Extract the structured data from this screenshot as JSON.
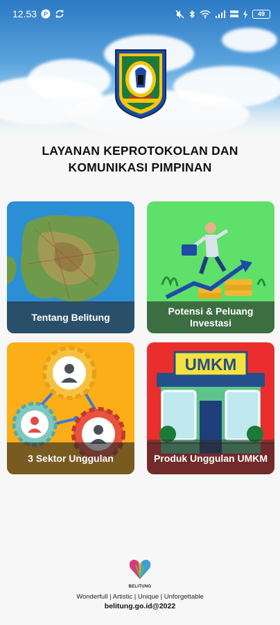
{
  "status_bar": {
    "time": "12.53",
    "battery": "49",
    "left_icons": [
      "parking-notification-icon",
      "sync-icon"
    ],
    "right_icons": [
      "mute-icon",
      "bluetooth-icon",
      "wifi-icon",
      "signal-icon",
      "data-speed-icon",
      "charging-icon"
    ]
  },
  "header": {
    "title_line1": "LAYANAN KEPROTOKOLAN DAN",
    "title_line2": "KOMUNIKASI PIMPINAN"
  },
  "menu": {
    "items": [
      {
        "label": "Tentang Belitung",
        "icon": "island-map-icon",
        "bg_color": "#2b8fd6"
      },
      {
        "label": "Potensi & Peluang Investasi",
        "icon": "investment-growth-icon",
        "bg_color": "#5ee06a"
      },
      {
        "label": "3 Sektor Unggulan",
        "icon": "gear-people-icon",
        "bg_color": "#fbae17"
      },
      {
        "label": "Produk Unggulan UMKM",
        "icon": "umkm-store-icon",
        "bg_color": "#ea2e2e",
        "sign_text": "UMKM"
      }
    ]
  },
  "footer": {
    "brand": "BELITUNG",
    "tagline": "Wonderfull | Artistic | Unique | Unforgettable",
    "site": "belitung.go.id@2022"
  },
  "colors": {
    "accent_text": "#111111",
    "label_overlay": "#282828",
    "sky": "#2c79c4"
  }
}
